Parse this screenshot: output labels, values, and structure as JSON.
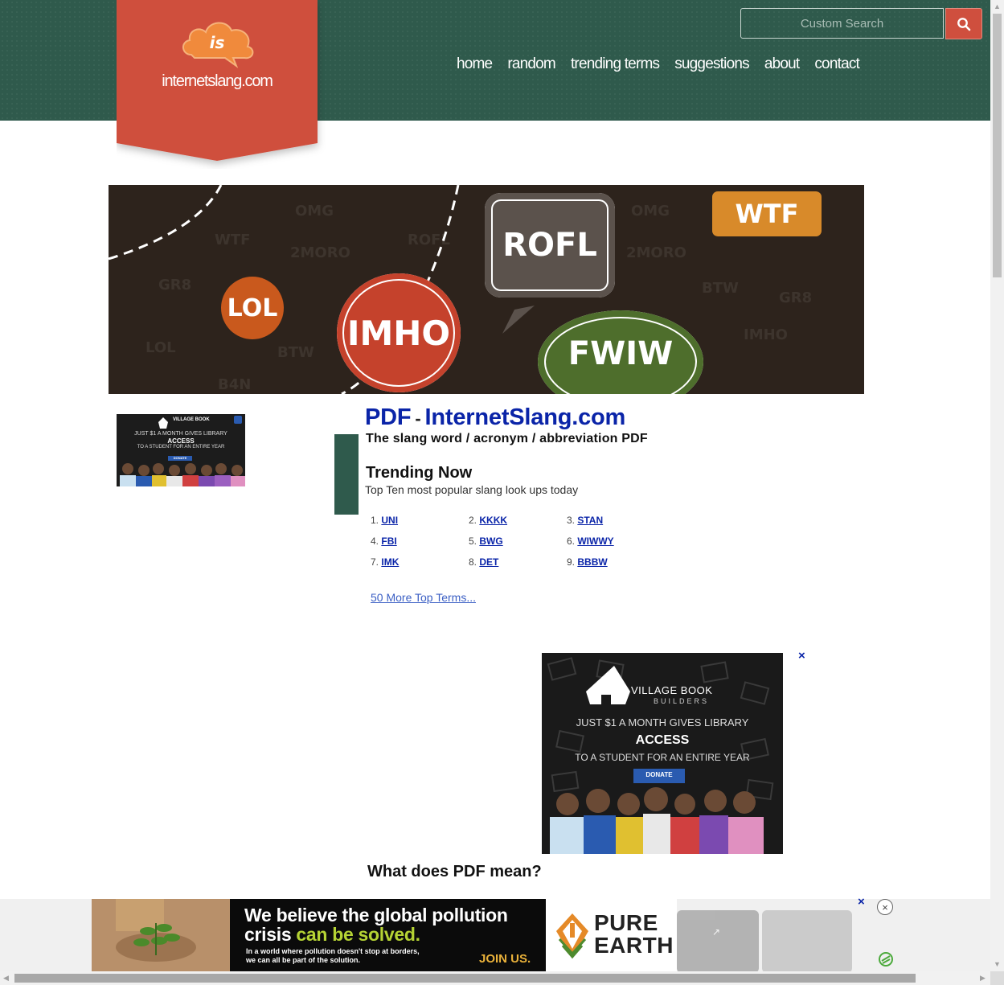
{
  "site": {
    "name": "internetslang.com",
    "logo_mark": "is"
  },
  "search": {
    "placeholder": "Custom Search",
    "button_icon": "search-icon"
  },
  "nav": {
    "items": [
      "home",
      "random",
      "trending terms",
      "suggestions",
      "about",
      "contact"
    ]
  },
  "banner": {
    "bubbles": [
      "LOL",
      "IMHO",
      "ROFL",
      "FWIW",
      "WTF"
    ],
    "background_words": [
      "OMG",
      "WTF",
      "2MORO",
      "GR8",
      "BTW",
      "ROFL",
      "IMHO",
      "LOL",
      "B4N"
    ]
  },
  "page": {
    "term": "PDF",
    "separator": "-",
    "site_title": "InternetSlang.com",
    "subtitle": "The slang word / acronym / abbreviation PDF"
  },
  "trending": {
    "heading": "Trending Now",
    "subheading": "Top Ten most popular slang look ups today",
    "items": [
      {
        "num": "1.",
        "term": "UNI"
      },
      {
        "num": "2.",
        "term": "KKKK"
      },
      {
        "num": "3.",
        "term": "STAN"
      },
      {
        "num": "4.",
        "term": "FBI"
      },
      {
        "num": "5.",
        "term": "BWG"
      },
      {
        "num": "6.",
        "term": "WIWWY"
      },
      {
        "num": "7.",
        "term": "IMK"
      },
      {
        "num": "8.",
        "term": "DET"
      },
      {
        "num": "9.",
        "term": "BBBW"
      }
    ],
    "more_link": "50 More Top Terms..."
  },
  "ads": {
    "village": {
      "brand": "VILLAGE BOOK",
      "brand_sub": "BUILDERS",
      "line1": "JUST $1 A MONTH GIVES LIBRARY",
      "line2": "ACCESS",
      "line3": "TO A STUDENT FOR AN ENTIRE YEAR",
      "cta": "DONATE"
    },
    "close": "×",
    "bottom": {
      "headline_a": "We believe the global pollution",
      "headline_b": "crisis ",
      "headline_green": "can be solved.",
      "small_a": "In a world where pollution doesn't stop at borders,",
      "small_b": "we can all be part of the solution.",
      "cta": "JOIN US.",
      "brand_a": "PURE",
      "brand_b": "EARTH"
    },
    "round_close": "×"
  },
  "question": {
    "heading": "What does PDF mean?"
  },
  "colors": {
    "header": "#2f5a4c",
    "badge": "#cf4f3e",
    "link": "#0a24a8"
  }
}
